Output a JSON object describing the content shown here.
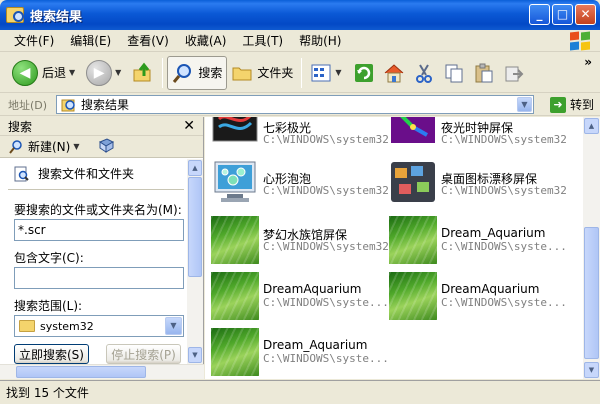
{
  "window": {
    "title": "搜索结果",
    "controls": {
      "minimize": "_",
      "maximize": "□",
      "close": "✕"
    }
  },
  "menu": {
    "items": [
      "文件(F)",
      "编辑(E)",
      "查看(V)",
      "收藏(A)",
      "工具(T)",
      "帮助(H)"
    ]
  },
  "toolbar": {
    "back_label": "后退",
    "search_label": "搜索",
    "folders_label": "文件夹",
    "more_glyph": "»"
  },
  "address": {
    "label": "地址(D)",
    "value": "搜索结果",
    "go_label": "转到"
  },
  "search_pane": {
    "header": "搜索",
    "new_label": "新建(N)",
    "title": "搜索文件和文件夹",
    "name_label": "要搜索的文件或文件夹名为(M):",
    "name_value": "*.scr",
    "text_label": "包含文字(C):",
    "text_value": "",
    "lookin_label": "搜索范围(L):",
    "lookin_value": "system32",
    "search_now_label": "立即搜索(S)",
    "stop_label": "停止搜索(P)"
  },
  "results": {
    "items": [
      {
        "name": "七彩极光",
        "path": "C:\\WINDOWS\\system32",
        "icon": "aurora-screensaver-icon"
      },
      {
        "name": "夜光时钟屏保",
        "path": "C:\\WINDOWS\\system32",
        "icon": "clock-screensaver-icon"
      },
      {
        "name": "心形泡泡",
        "path": "C:\\WINDOWS\\system32",
        "icon": "bubbles-monitor-icon"
      },
      {
        "name": "桌面图标漂移屏保",
        "path": "C:\\WINDOWS\\system32",
        "icon": "desktop-icons-screensaver-icon"
      },
      {
        "name": "梦幻水族馆屏保",
        "path": "C:\\WINDOWS\\system32",
        "icon": "aquarium-grass-icon"
      },
      {
        "name": "Dream_Aquarium",
        "path": "C:\\WINDOWS\\syste...",
        "icon": "aquarium-grass-icon"
      },
      {
        "name": "DreamAquarium",
        "path": "C:\\WINDOWS\\syste...",
        "icon": "aquarium-grass-icon"
      },
      {
        "name": "DreamAquarium",
        "path": "C:\\WINDOWS\\syste...",
        "icon": "aquarium-grass-icon"
      },
      {
        "name": "Dream_Aquarium",
        "path": "C:\\WINDOWS\\syste...",
        "icon": "aquarium-grass-icon"
      }
    ]
  },
  "status": {
    "text": "找到 15 个文件"
  }
}
